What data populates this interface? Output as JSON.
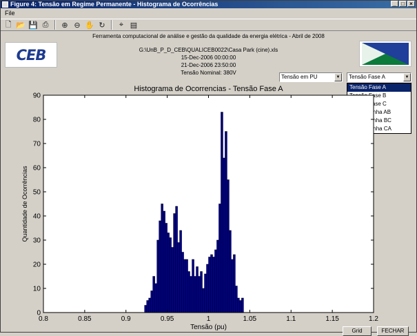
{
  "window": {
    "title": "Figure 4: Tensão em Regime Permanente - Histograma de Ocorrências"
  },
  "menu": {
    "file": "File"
  },
  "toolbar": {
    "icons": [
      "new-icon",
      "open-icon",
      "save-icon",
      "print-icon",
      "zoom-in-icon",
      "zoom-out-icon",
      "pan-icon",
      "rotate-icon",
      "data-cursor-icon",
      "colorbar-icon"
    ]
  },
  "header": {
    "tool_title": "Ferramenta computacional de análise e gestão da qualidade da energia elétrica - Abril de 2008",
    "file_path": "G:\\UnB_P_D_CEB\\QUALICEB0022\\Casa Park (cine).xls",
    "start": "15-Dec-2006 00:00:00",
    "end": "21-Dec-2006 23:50:00",
    "nominal": "Tensão Nominal: 380V"
  },
  "logos": {
    "ceb": "CEB"
  },
  "controls": {
    "unit_select": "Tensão em PU",
    "phase_select": "Tensão Fase A",
    "phase_options": [
      "Tensão Fase A",
      "Tensão Fase B",
      "Tensão Fase C",
      "Tensão Linha AB",
      "Tensão Linha BC",
      "Tensão Linha CA"
    ]
  },
  "buttons": {
    "grid": "Grid",
    "close": "FECHAR"
  },
  "chart_data": {
    "type": "bar",
    "title": "Histograma de Ocorrencias - Tensão Fase A",
    "xlabel": "Tensão (pu)",
    "ylabel": "Quantidade de Ocorrências",
    "xlim": [
      0.8,
      1.2
    ],
    "ylim": [
      0,
      90
    ],
    "xticks": [
      "0.8",
      "0.85",
      "0.9",
      "0.95",
      "1",
      "1.05",
      "1.1",
      "1.15",
      "1.2"
    ],
    "yticks": [
      "0",
      "10",
      "20",
      "30",
      "40",
      "50",
      "60",
      "70",
      "80",
      "90"
    ],
    "bar_color": "#00008b",
    "bin_start": 0.9225,
    "bin_width": 0.0025,
    "values": [
      3,
      5,
      6,
      9,
      15,
      12,
      30,
      38,
      45,
      42,
      37,
      33,
      31,
      27,
      41,
      44,
      29,
      34,
      25,
      22,
      22,
      17,
      15,
      22,
      15,
      19,
      15,
      17,
      10,
      16,
      20,
      23,
      24,
      23,
      26,
      30,
      45,
      83,
      64,
      75,
      55,
      34,
      22,
      24,
      11,
      6,
      5,
      6
    ]
  }
}
